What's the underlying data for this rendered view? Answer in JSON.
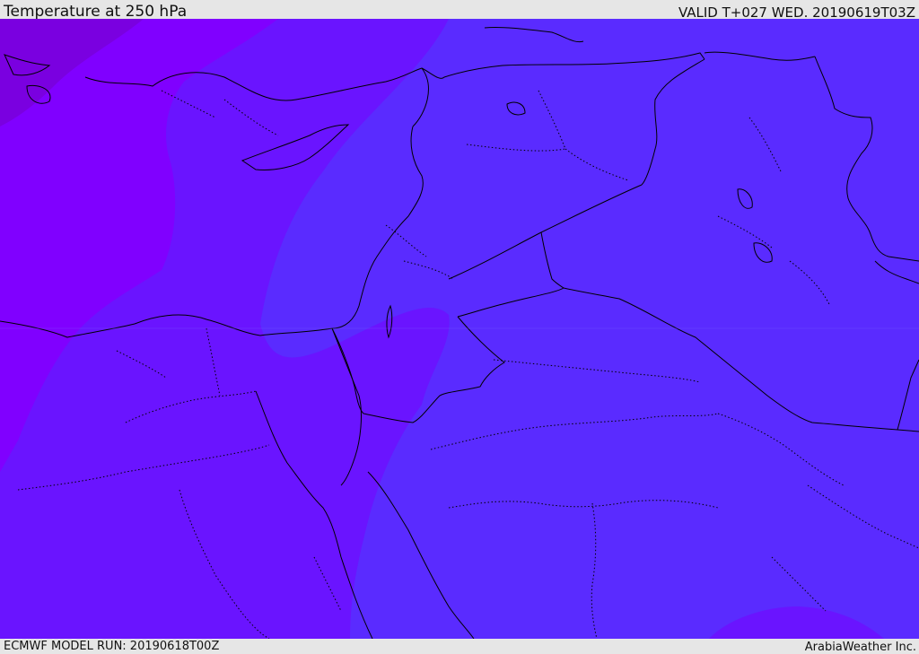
{
  "header": {
    "title": "Temperature at 250 hPa",
    "valid": "VALID T+027 WED. 20190619T03Z"
  },
  "footer": {
    "model_run": "ECMWF MODEL RUN: 20190618T00Z",
    "credit": "ArabiaWeather Inc."
  },
  "map": {
    "field": "temperature",
    "level": "250 hPa",
    "colors": {
      "background_fill": "#5a2bff",
      "band_mid": "#6a14ff",
      "band_warm": "#8000ff",
      "band_deep": "#7a00e0",
      "border_line": "#000000"
    },
    "icons": [
      "coastline-icon",
      "national-border-icon",
      "province-border-icon"
    ]
  }
}
